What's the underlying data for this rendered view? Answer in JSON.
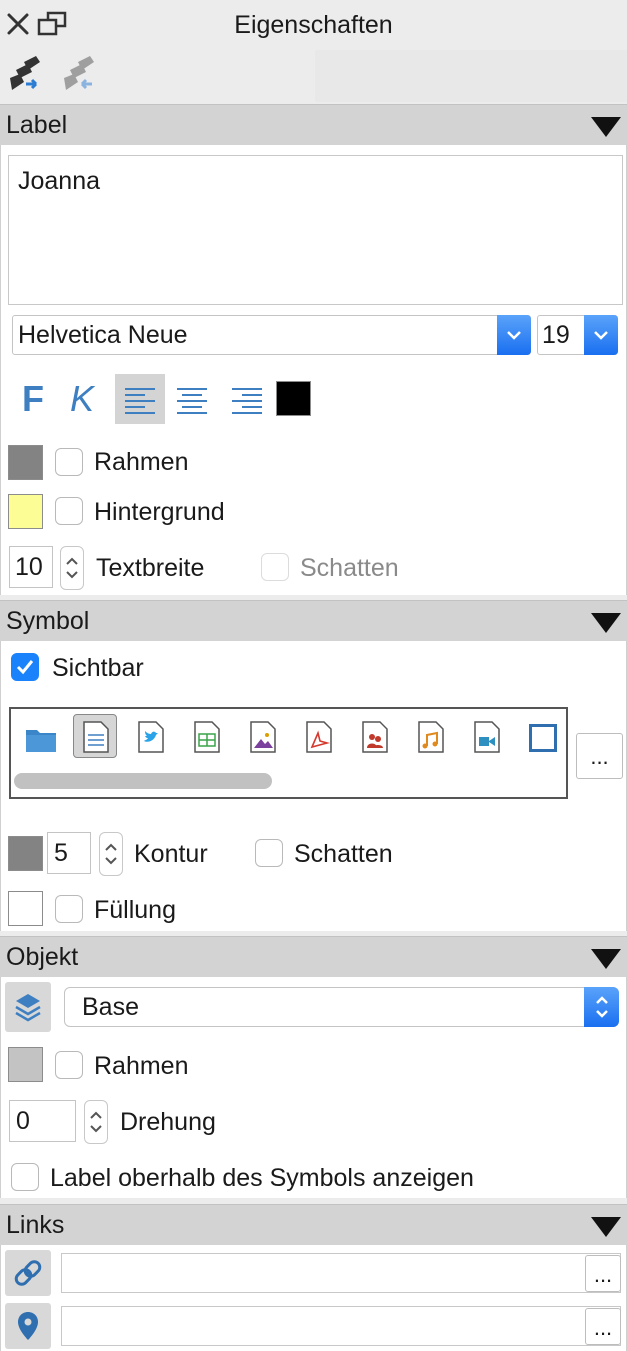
{
  "window": {
    "title": "Eigenschaften"
  },
  "sections": {
    "label": {
      "title": "Label",
      "text": "Joanna",
      "font": "Helvetica Neue",
      "size": "19",
      "bold_label": "F",
      "italic_label": "K",
      "frame_label": "Rahmen",
      "background_label": "Hintergrund",
      "text_width_value": "10",
      "text_width_label": "Textbreite",
      "shadow_label": "Schatten",
      "text_color": "#000000",
      "frame_color": "#838383",
      "background_color": "#fdfd96"
    },
    "symbol": {
      "title": "Symbol",
      "visible_label": "Sichtbar",
      "icons": [
        "folder-icon",
        "document-icon",
        "twitter-icon",
        "spreadsheet-icon",
        "image-icon",
        "pdf-icon",
        "contacts-icon",
        "music-icon",
        "video-icon",
        "square-icon"
      ],
      "more_label": "...",
      "outline_value": "5",
      "outline_label": "Kontur",
      "shadow_label": "Schatten",
      "fill_label": "Füllung"
    },
    "object": {
      "title": "Objekt",
      "layer": "Base",
      "frame_label": "Rahmen",
      "rotation_value": "0",
      "rotation_label": "Drehung",
      "label_above_label": "Label oberhalb des Symbols anzeigen"
    },
    "links": {
      "title": "Links",
      "link_value": "",
      "location_value": "",
      "more_label": "..."
    }
  },
  "colors": {
    "accent": "#1a82fb",
    "icon_blue": "#3e7fc1"
  }
}
